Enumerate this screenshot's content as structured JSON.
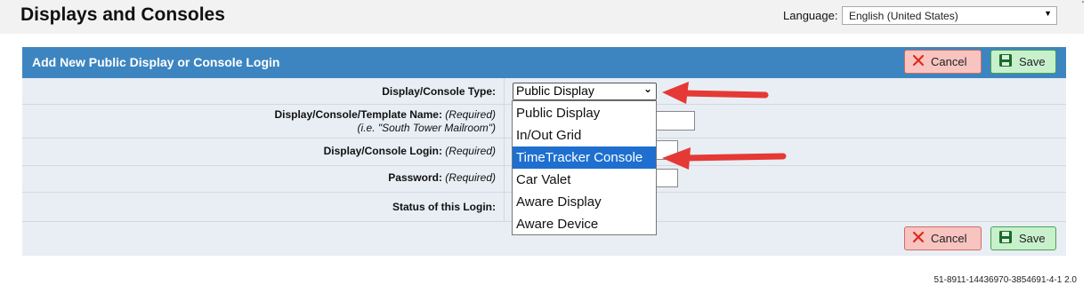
{
  "header": {
    "title": "Displays and Consoles",
    "language_label": "Language:",
    "language_value": "English (United States)"
  },
  "panel": {
    "title": "Add New Public Display or Console Login",
    "cancel_label": "Cancel",
    "save_label": "Save"
  },
  "form": {
    "type_label": "Display/Console Type:",
    "type_value": "Public Display",
    "name_label": "Display/Console/Template Name:",
    "name_required": "(Required)",
    "name_hint": "(i.e. \"South Tower Mailroom\")",
    "login_label": "Display/Console Login:",
    "login_required": "(Required)",
    "password_label": "Password:",
    "password_required": "(Required)",
    "status_label": "Status of this Login:"
  },
  "dropdown": {
    "options": [
      "Public Display",
      "In/Out Grid",
      "TimeTracker Console",
      "Car Valet",
      "Aware Display",
      "Aware Device"
    ],
    "highlighted": "TimeTracker Console"
  },
  "colors": {
    "header_blue": "#3d85c0",
    "highlight": "#1e6fcf",
    "annotation_arrow": "#e53935"
  },
  "footer": {
    "version": "51-8911-14436970-3854691-4-1 2.0"
  }
}
